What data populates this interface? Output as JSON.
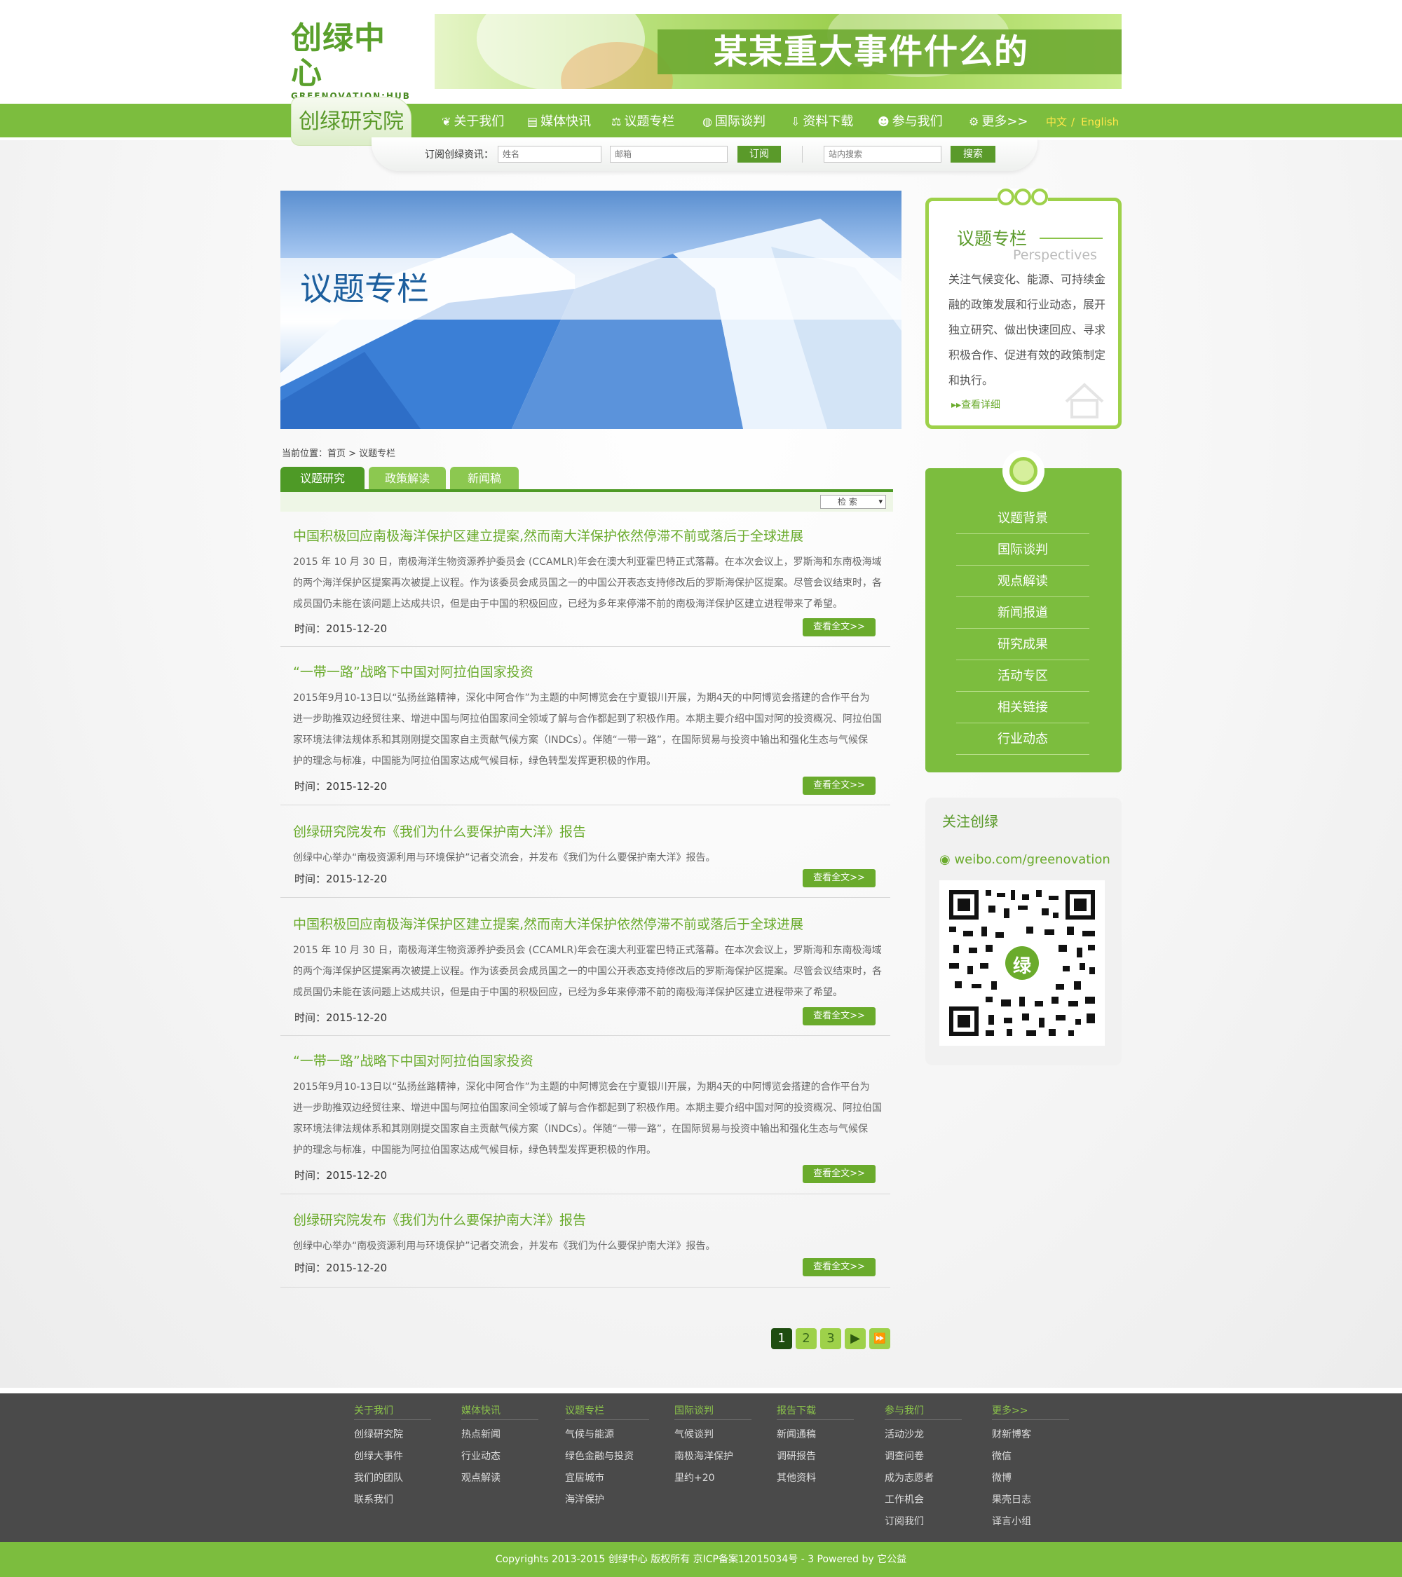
{
  "header": {
    "logo_cn": "创绿中心",
    "logo_en": "GREENOVATION:HUB",
    "banner_text": "某某重大事件什么的"
  },
  "nav": {
    "section_tab": "创绿研究院",
    "items": [
      {
        "label": "关于我们",
        "icon": "leaf-icon"
      },
      {
        "label": "媒体快讯",
        "icon": "document-icon"
      },
      {
        "label": "议题专栏",
        "icon": "scale-icon"
      },
      {
        "label": "国际谈判",
        "icon": "globe-icon"
      },
      {
        "label": "资料下载",
        "icon": "download-icon"
      },
      {
        "label": "参与我们",
        "icon": "people-icon"
      },
      {
        "label": "更多>>",
        "icon": "gear-icon"
      }
    ],
    "lang_cn": "中文",
    "lang_sep": "/",
    "lang_en": "English"
  },
  "subscribe": {
    "label": "订阅创绿资讯：",
    "name_placeholder": "姓名",
    "email_placeholder": "邮箱",
    "subscribe_btn": "订阅",
    "search_placeholder": "站内搜索",
    "search_btn": "搜索"
  },
  "hero": {
    "title": "议题专栏"
  },
  "breadcrumb": "当前位置：首页 > 议题专栏",
  "tabs": [
    {
      "label": "议题研究",
      "active": true
    },
    {
      "label": "政策解读",
      "active": false
    },
    {
      "label": "新闻稿",
      "active": false
    }
  ],
  "filter_select": "检 索",
  "articles": [
    {
      "title": "中国积极回应南极海洋保护区建立提案,然而南大洋保护依然停滞不前或落后于全球进展",
      "lines": [
        "2015 年 10 月 30 日，南极海洋生物资源养护委员会 (CCAMLR)年会在澳大利亚霍巴特正式落幕。在本次会议上，罗斯海和东南极海域",
        "的两个海洋保护区提案再次被提上议程。作为该委员会成员国之一的中国公开表态支持修改后的罗斯海保护区提案。尽管会议结束时，各",
        "成员国仍未能在该问题上达成共识，但是由于中国的积极回应，已经为多年来停滞不前的南极海洋保护区建立进程带来了希望。"
      ],
      "time": "时间：2015-12-20",
      "more": "查看全文>>"
    },
    {
      "title": "“一带一路”战略下中国对阿拉伯国家投资",
      "lines": [
        "2015年9月10-13日以“弘扬丝路精神，深化中阿合作”为主题的中阿博览会在宁夏银川开展，为期4天的中阿博览会搭建的合作平台为",
        "进一步助推双边经贸往来、增进中国与阿拉伯国家间全领域了解与合作都起到了积极作用。本期主要介绍中国对阿的投资概况、阿拉伯国",
        "家环境法律法规体系和其刚刚提交国家自主贡献气候方案（INDCs）。伴随“一带一路”，在国际贸易与投资中输出和强化生态与气候保",
        "护的理念与标准，中国能为阿拉伯国家达成气候目标，绿色转型发挥更积极的作用。"
      ],
      "time": "时间：2015-12-20",
      "more": "查看全文>>"
    },
    {
      "title": "创绿研究院发布《我们为什么要保护南大洋》报告",
      "lines": [
        "创绿中心举办“南极资源利用与环境保护”记者交流会，并发布《我们为什么要保护南大洋》报告。"
      ],
      "time": "时间：2015-12-20",
      "more": "查看全文>>"
    },
    {
      "title": "中国积极回应南极海洋保护区建立提案,然而南大洋保护依然停滞不前或落后于全球进展",
      "lines": [
        "2015 年 10 月 30 日，南极海洋生物资源养护委员会 (CCAMLR)年会在澳大利亚霍巴特正式落幕。在本次会议上，罗斯海和东南极海域",
        "的两个海洋保护区提案再次被提上议程。作为该委员会成员国之一的中国公开表态支持修改后的罗斯海保护区提案。尽管会议结束时，各",
        "成员国仍未能在该问题上达成共识，但是由于中国的积极回应，已经为多年来停滞不前的南极海洋保护区建立进程带来了希望。"
      ],
      "time": "时间：2015-12-20",
      "more": "查看全文>>"
    },
    {
      "title": "“一带一路”战略下中国对阿拉伯国家投资",
      "lines": [
        "2015年9月10-13日以“弘扬丝路精神，深化中阿合作”为主题的中阿博览会在宁夏银川开展，为期4天的中阿博览会搭建的合作平台为",
        "进一步助推双边经贸往来、增进中国与阿拉伯国家间全领域了解与合作都起到了积极作用。本期主要介绍中国对阿的投资概况、阿拉伯国",
        "家环境法律法规体系和其刚刚提交国家自主贡献气候方案（INDCs）。伴随“一带一路”，在国际贸易与投资中输出和强化生态与气候保",
        "护的理念与标准，中国能为阿拉伯国家达成气候目标，绿色转型发挥更积极的作用。"
      ],
      "time": "时间：2015-12-20",
      "more": "查看全文>>"
    },
    {
      "title": "创绿研究院发布《我们为什么要保护南大洋》报告",
      "lines": [
        "创绿中心举办“南极资源利用与环境保护”记者交流会，并发布《我们为什么要保护南大洋》报告。"
      ],
      "time": "时间：2015-12-20",
      "more": "查看全文>>"
    }
  ],
  "pagination": {
    "pages": [
      "1",
      "2",
      "3"
    ],
    "current": 1,
    "next": "▶",
    "last": "⏩"
  },
  "sidebar_intro": {
    "title": "议题专栏",
    "subtitle": "Perspectives",
    "lines": [
      "关注气候变化、能源、可持续金",
      "融的政策发展和行业动态，展开",
      "独立研究、做出快速回应、寻求",
      "积极合作、促进有效的政策制定",
      "和执行。"
    ],
    "link": "查看详细"
  },
  "sidebar_menu": [
    "议题背景",
    "国际谈判",
    "观点解读",
    "新闻报道",
    "研究成果",
    "活动专区",
    "相关链接",
    "行业动态"
  ],
  "follow": {
    "title": "关注创绿",
    "weibo": "weibo.com/greenovation",
    "qr_center": "绿"
  },
  "footer": {
    "columns": [
      {
        "head": "关于我们",
        "items": [
          "创绿研究院",
          "创绿大事件",
          "我们的团队",
          "联系我们"
        ]
      },
      {
        "head": "媒体快讯",
        "items": [
          "热点新闻",
          "行业动态",
          "观点解读"
        ]
      },
      {
        "head": "议题专栏",
        "items": [
          "气候与能源",
          "绿色金融与投资",
          "宜居城市",
          "海洋保护"
        ]
      },
      {
        "head": "国际谈判",
        "items": [
          "气候谈判",
          "南极海洋保护",
          "里约+20"
        ]
      },
      {
        "head": "报告下载",
        "items": [
          "新闻通稿",
          "调研报告",
          "其他资料"
        ]
      },
      {
        "head": "参与我们",
        "items": [
          "活动沙龙",
          "调查问卷",
          "成为志愿者",
          "工作机会",
          "订阅我们"
        ]
      },
      {
        "head": "更多>>",
        "items": [
          "财新博客",
          "微信",
          "微博",
          "果壳日志",
          "译言小组"
        ]
      }
    ],
    "copyright": "Copyrights 2013-2015  创绿中心 版权所有  京ICP备案12015034号 - 3  Powered by 它公益"
  }
}
